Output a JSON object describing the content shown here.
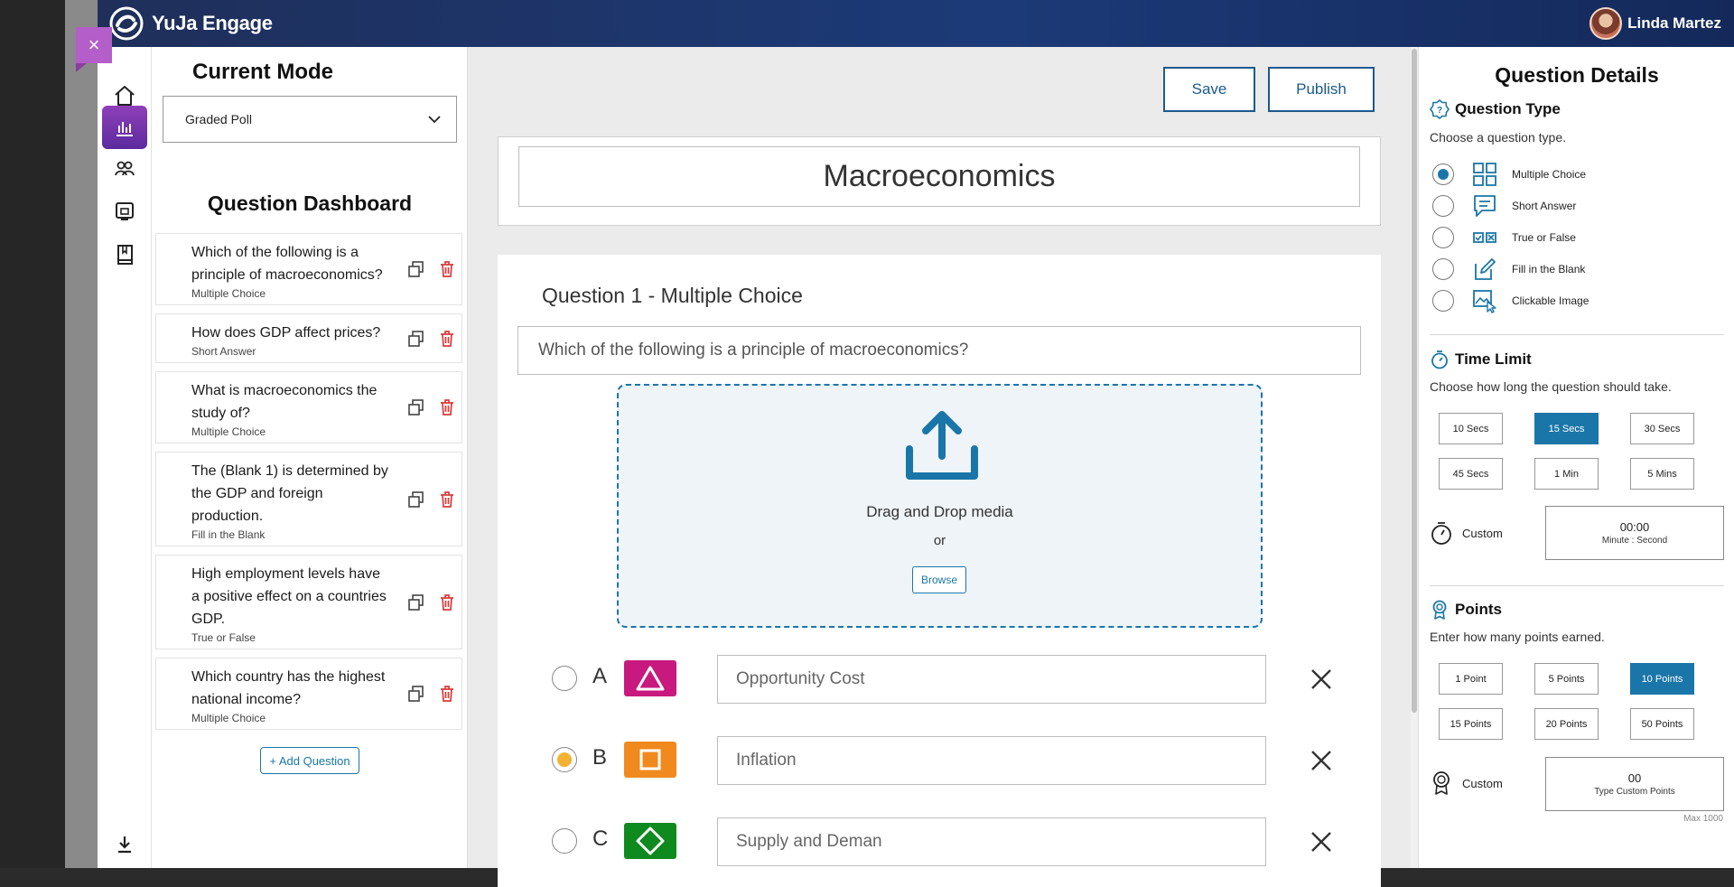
{
  "header": {
    "app_name": "YuJa Engage",
    "user_name": "Linda Martez"
  },
  "close_label": "×",
  "dashboard": {
    "mode_title": "Current Mode",
    "mode_value": "Graded Poll",
    "questions_title": "Question Dashboard",
    "questions": [
      {
        "text": "Which of the following is a principle of macroeconomics?",
        "type": "Multiple Choice"
      },
      {
        "text": "How does GDP affect prices?",
        "type": "Short Answer"
      },
      {
        "text": "What is macroeconomics the study of?",
        "type": "Multiple Choice"
      },
      {
        "text": "The (Blank 1) is determined by the GDP and foreign production.",
        "type": "Fill in the Blank"
      },
      {
        "text": "High employment levels have a positive effect on a countries GDP.",
        "type": "True or False"
      },
      {
        "text": "Which country has the highest national income?",
        "type": "Multiple Choice"
      }
    ],
    "add_question": "+ Add Question"
  },
  "editor": {
    "save": "Save",
    "publish": "Publish",
    "poll_title": "Macroeconomics",
    "question_heading": "Question 1 - Multiple Choice",
    "question_text": "Which of the following is a principle of macroeconomics?",
    "drag_drop": "Drag and Drop media",
    "or": "or",
    "browse": "Browse",
    "options": [
      {
        "letter": "A",
        "text": "Opportunity Cost",
        "shape": "triangle",
        "color": "#c8197e",
        "selected": false
      },
      {
        "letter": "B",
        "text": "Inflation",
        "shape": "square",
        "color": "#f08a1e",
        "selected": true
      },
      {
        "letter": "C",
        "text": "Supply and Deman",
        "shape": "diamond",
        "color": "#0f8a1e",
        "selected": false
      }
    ]
  },
  "details": {
    "title": "Question Details",
    "question_type": {
      "heading": "Question Type",
      "sub": "Choose a question type.",
      "items": [
        {
          "label": "Multiple Choice",
          "icon": "grid-icon",
          "selected": true
        },
        {
          "label": "Short Answer",
          "icon": "chat-lines-icon",
          "selected": false
        },
        {
          "label": "True or False",
          "icon": "check-boxes-icon",
          "selected": false
        },
        {
          "label": "Fill in the Blank",
          "icon": "edit-icon",
          "selected": false
        },
        {
          "label": "Clickable Image",
          "icon": "image-cursor-icon",
          "selected": false
        }
      ]
    },
    "time_limit": {
      "heading": "Time Limit",
      "sub": "Choose how long the question should take.",
      "options": [
        "10 Secs",
        "15 Secs",
        "30 Secs",
        "45 Secs",
        "1 Min",
        "5 Mins"
      ],
      "selected": "15 Secs",
      "custom_label": "Custom",
      "custom_value": "00:00",
      "custom_hint": "Minute : Second"
    },
    "points": {
      "heading": "Points",
      "sub": "Enter how many points earned.",
      "options": [
        "1 Point",
        "5 Points",
        "10 Points",
        "15 Points",
        "20 Points",
        "50 Points"
      ],
      "selected": "10 Points",
      "custom_label": "Custom",
      "custom_value": "00",
      "custom_hint": "Type Custom Points",
      "max_note": "Max 1000"
    }
  },
  "colors": {
    "accent": "#1a76a8",
    "header": "#1c3a78",
    "rail_active": "#7b35b0",
    "delete": "#d63b3b"
  }
}
